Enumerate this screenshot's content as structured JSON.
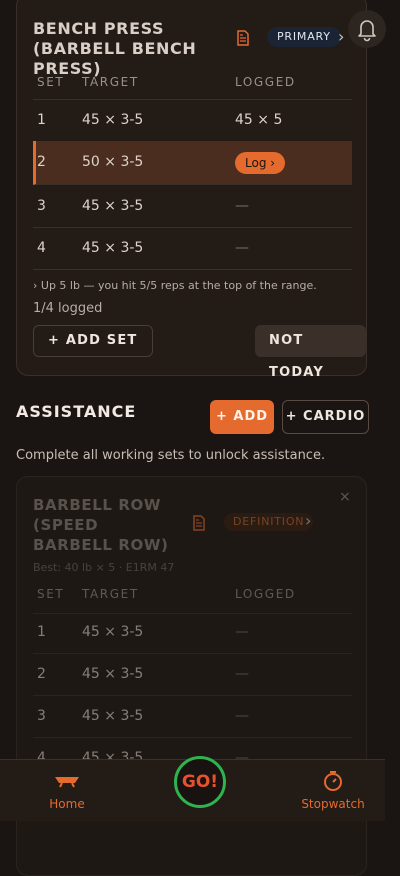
{
  "primary": {
    "title": "BENCH PRESS (BARBELL BENCH PRESS)",
    "badge": "PRIMARY",
    "headers": {
      "set": "SET",
      "target": "TARGET",
      "logged": "LOGGED"
    },
    "rows": [
      {
        "set": "1",
        "target": "45 × 3-5",
        "logged": "45 × 5"
      },
      {
        "set": "2",
        "target": "50 × 3-5",
        "logged": "Log ›"
      },
      {
        "set": "3",
        "target": "45 × 3-5",
        "logged": "—"
      },
      {
        "set": "4",
        "target": "45 × 3-5",
        "logged": "—"
      }
    ],
    "hint": "›  Up 5 lb — you hit 5/5 reps at the top of the range.",
    "logged_count": "1/4 logged",
    "add_set_label": "+ ADD SET",
    "not_today_label": "NOT TODAY"
  },
  "assistance": {
    "title": "ASSISTANCE",
    "add_label": "+ ADD",
    "cardio_label": "+ CARDIO",
    "note": "Complete all working sets to unlock assistance."
  },
  "assist_exercise": {
    "title": "BARBELL ROW (SPEED BARBELL ROW)",
    "badge": "DEFINITION",
    "best": "Best: 40 lb × 5 · E1RM 47",
    "close_label": "×",
    "headers": {
      "set": "SET",
      "target": "TARGET",
      "logged": "LOGGED"
    },
    "rows": [
      {
        "set": "1",
        "target": "45 × 3-5",
        "logged": "—"
      },
      {
        "set": "2",
        "target": "45 × 3-5",
        "logged": "—"
      },
      {
        "set": "3",
        "target": "45 × 3-5",
        "logged": "—"
      },
      {
        "set": "4",
        "target": "45 × 3-5",
        "logged": "—"
      }
    ]
  },
  "nav": {
    "home_label": "Home",
    "go_label": "GO!",
    "stopwatch_label": "Stopwatch"
  },
  "colors": {
    "accent": "#e46a2e",
    "background": "#1a1512",
    "card": "#221b16",
    "go_ring": "#2fb34e"
  },
  "icons": {
    "notes": "document-icon",
    "bell": "bell-icon",
    "home": "barbell-icon",
    "stopwatch": "stopwatch-icon"
  }
}
